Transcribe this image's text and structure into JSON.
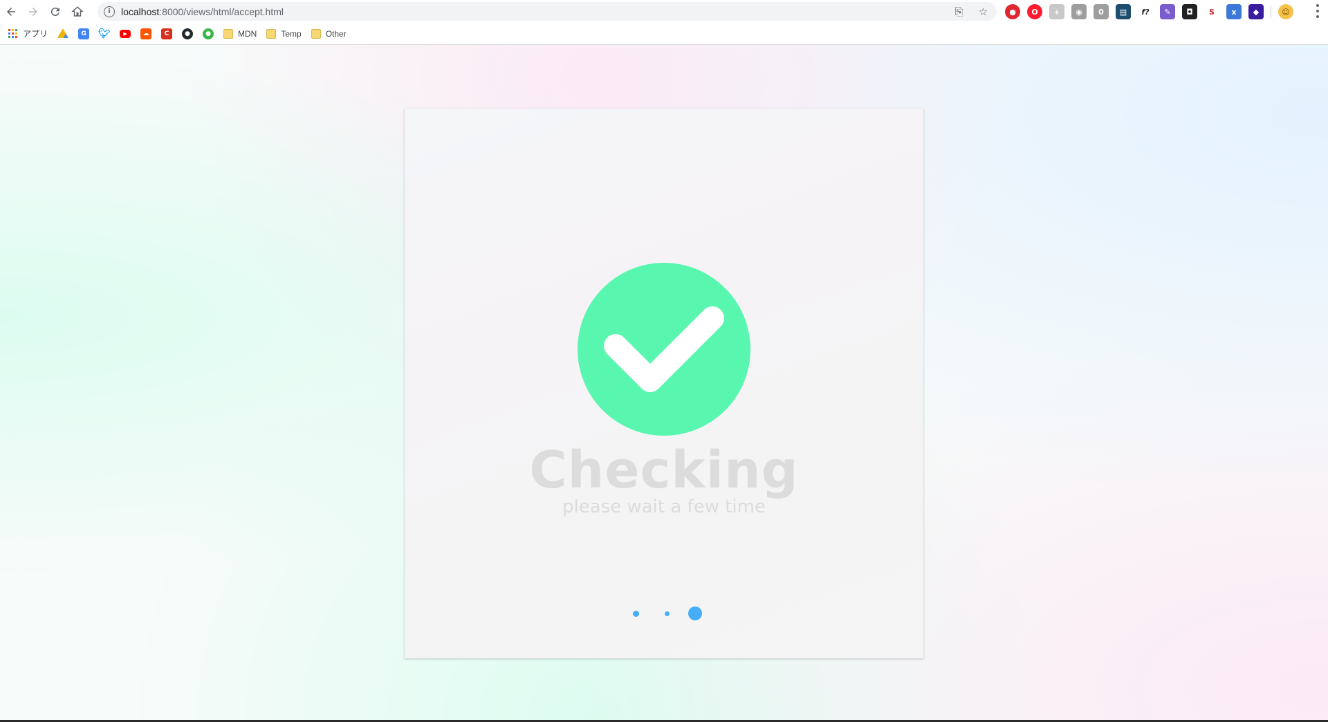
{
  "browser": {
    "url_host": "localhost",
    "url_path": ":8000/views/html/accept.html",
    "bookmarks": [
      {
        "label": "アプリ",
        "icon": "apps-grid-icon"
      },
      {
        "label": "",
        "icon": "google-drive-icon"
      },
      {
        "label": "",
        "icon": "google-translate-icon"
      },
      {
        "label": "",
        "icon": "twitter-icon"
      },
      {
        "label": "",
        "icon": "youtube-icon"
      },
      {
        "label": "",
        "icon": "soundcloud-icon"
      },
      {
        "label": "",
        "icon": "bookmark-red-icon"
      },
      {
        "label": "",
        "icon": "github-icon"
      },
      {
        "label": "",
        "icon": "green-app-icon"
      },
      {
        "label": "MDN",
        "icon": "folder-icon"
      },
      {
        "label": "Temp",
        "icon": "folder-icon"
      },
      {
        "label": "Other",
        "icon": "folder-icon"
      }
    ]
  },
  "page": {
    "title": "Checking",
    "subtitle": "please wait a few time",
    "check_color": "#59f6b0",
    "dot_color": "#46aef7",
    "title_color": "#dcdcdc"
  }
}
